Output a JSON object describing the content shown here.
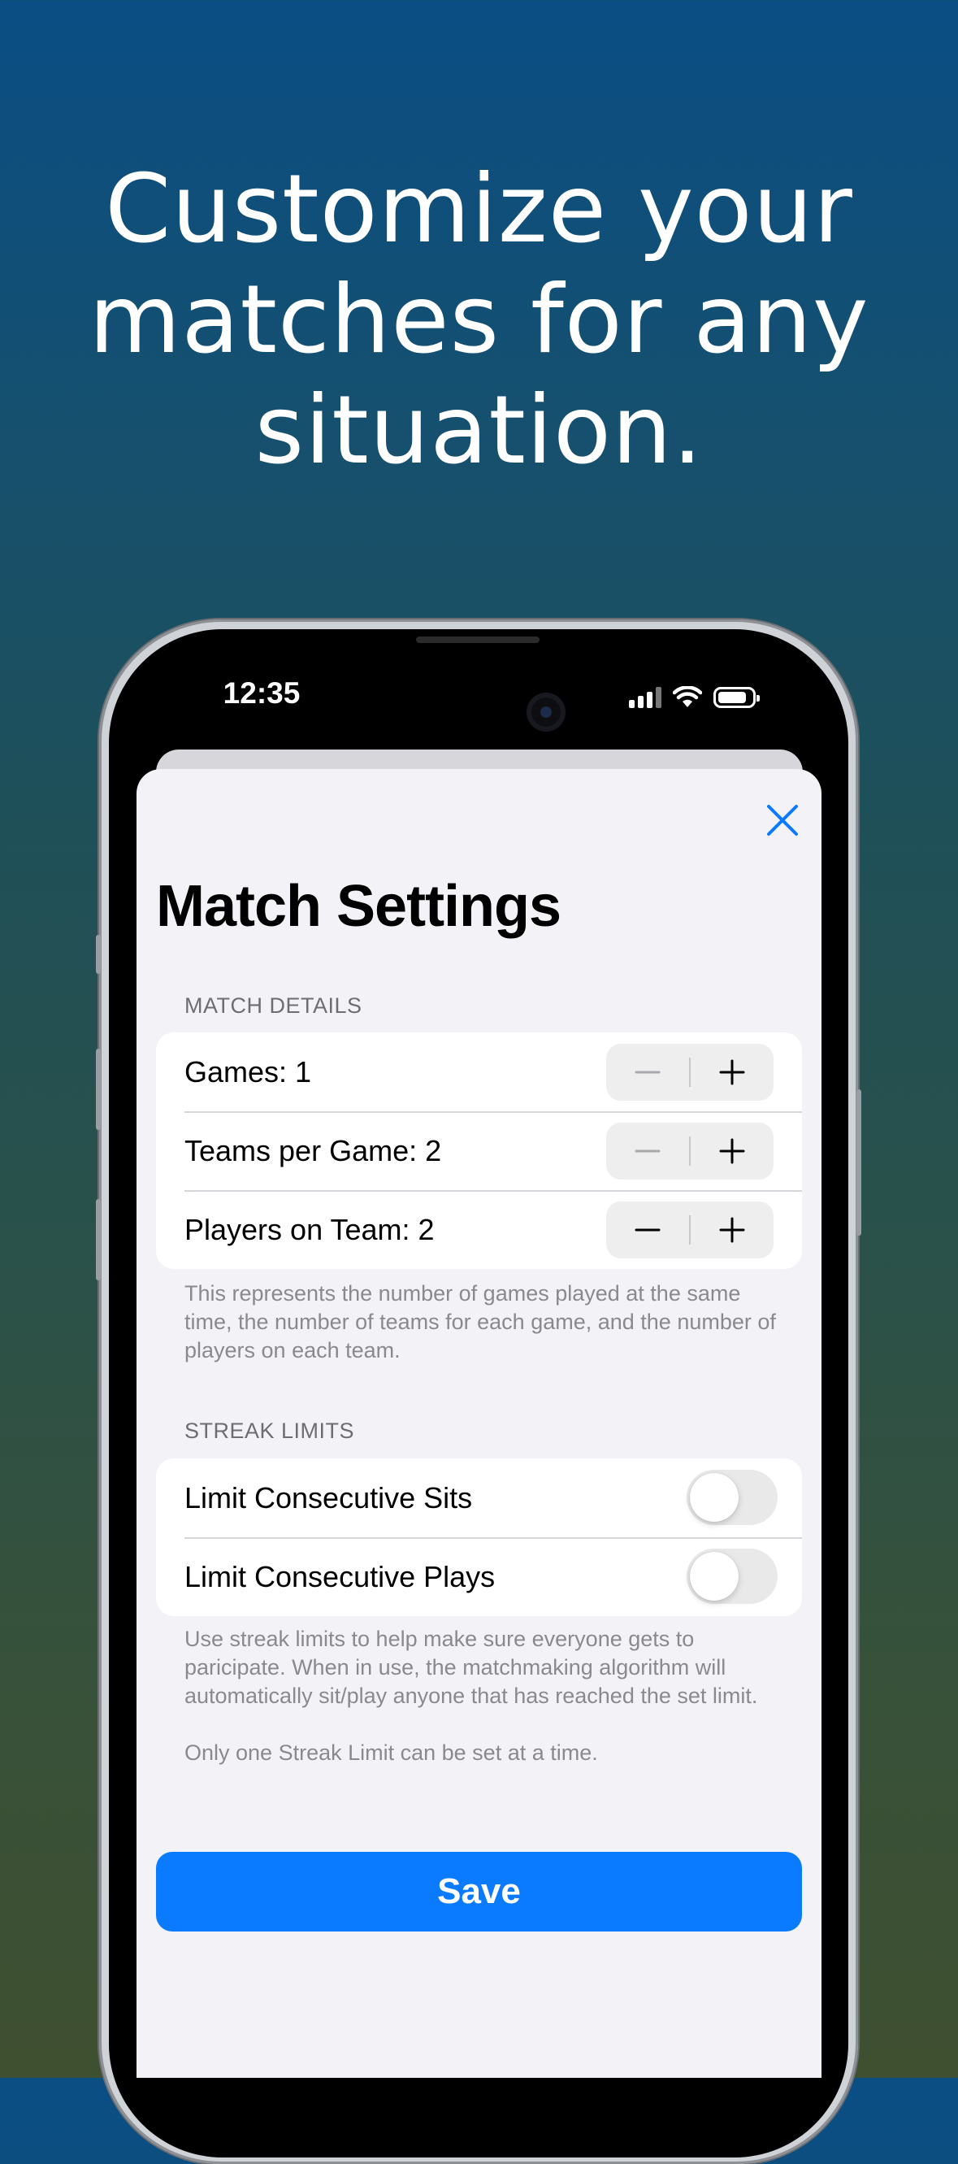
{
  "headline": {
    "line1": "Customize your",
    "line2": "matches for any",
    "line3": "situation."
  },
  "status_bar": {
    "time": "12:35"
  },
  "screen": {
    "title": "Match Settings",
    "close_icon": "close-icon",
    "match_details": {
      "header": "MATCH DETAILS",
      "rows": [
        {
          "label": "Games: 1"
        },
        {
          "label": "Teams per Game: 2"
        },
        {
          "label": "Players on Team: 2"
        }
      ],
      "footer": "This represents the number of games played at the same time, the number of teams for each game, and the number of players on each team."
    },
    "streak_limits": {
      "header": "STREAK LIMITS",
      "rows": [
        {
          "label": "Limit Consecutive Sits",
          "on": false
        },
        {
          "label": "Limit Consecutive Plays",
          "on": false
        }
      ],
      "footer1": "Use streak limits to help make sure everyone gets to paricipate. When in use, the matchmaking algorithm will automatically sit/play anyone that has reached the set limit.",
      "footer2": "Only one Streak Limit can be set at a time."
    },
    "save_label": "Save"
  },
  "colors": {
    "accent": "#0a7aff",
    "background_top": "#0a4e84",
    "background_bottom": "#3f5030"
  }
}
